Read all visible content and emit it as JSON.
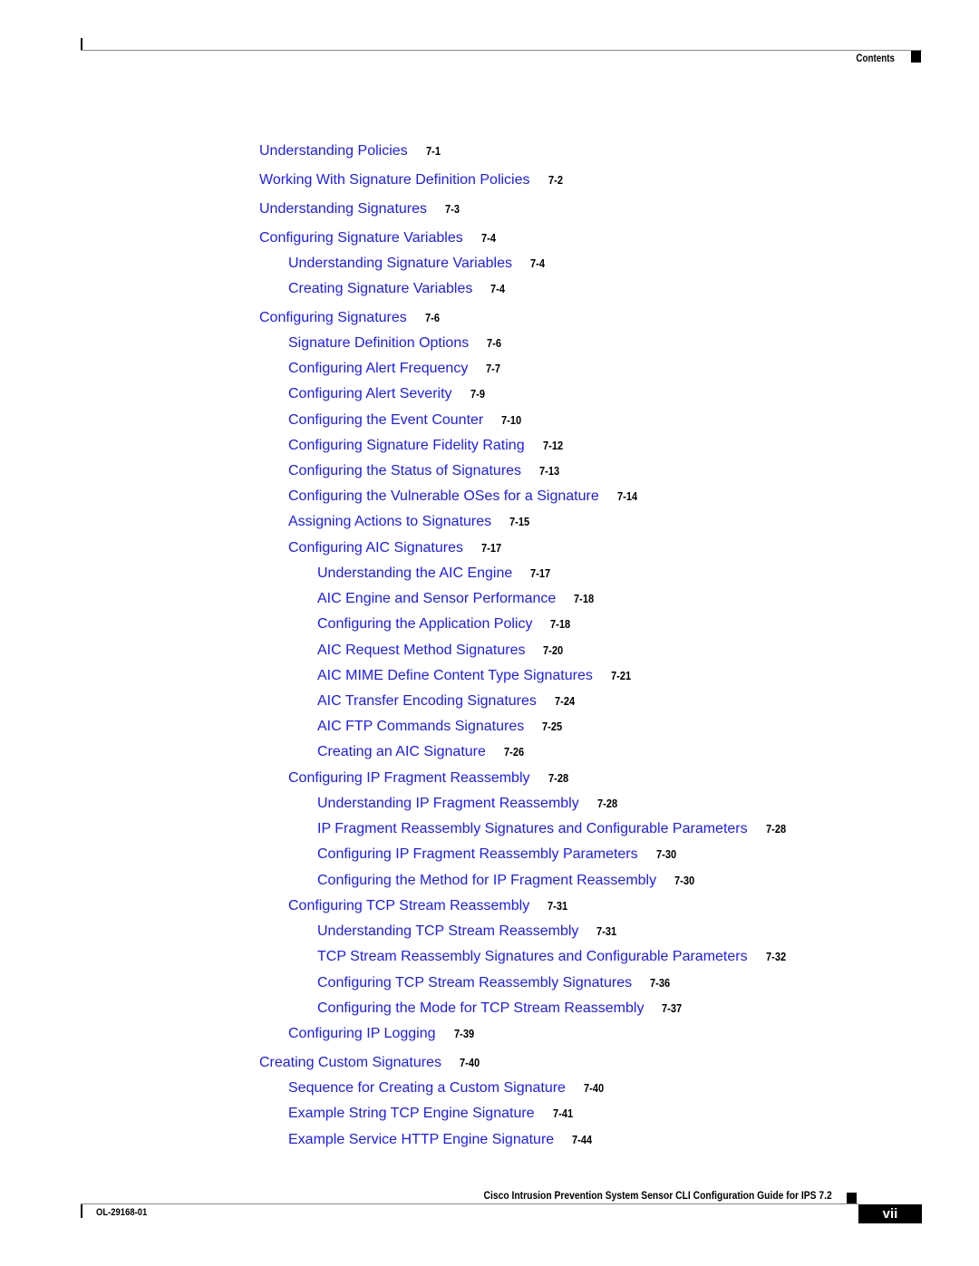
{
  "header": {
    "section_label": "Contents"
  },
  "toc": [
    {
      "level": 1,
      "title": "Understanding Policies",
      "page": "7-1"
    },
    {
      "level": 1,
      "title": "Working With Signature Definition Policies",
      "page": "7-2"
    },
    {
      "level": 1,
      "title": "Understanding Signatures",
      "page": "7-3"
    },
    {
      "level": 1,
      "title": "Configuring Signature Variables",
      "page": "7-4"
    },
    {
      "level": 2,
      "title": "Understanding Signature Variables",
      "page": "7-4"
    },
    {
      "level": 2,
      "title": "Creating Signature Variables",
      "page": "7-4"
    },
    {
      "level": 1,
      "title": "Configuring Signatures",
      "page": "7-6"
    },
    {
      "level": 2,
      "title": "Signature Definition Options",
      "page": "7-6"
    },
    {
      "level": 2,
      "title": "Configuring Alert Frequency",
      "page": "7-7"
    },
    {
      "level": 2,
      "title": "Configuring Alert Severity",
      "page": "7-9"
    },
    {
      "level": 2,
      "title": "Configuring the Event Counter",
      "page": "7-10"
    },
    {
      "level": 2,
      "title": "Configuring Signature Fidelity Rating",
      "page": "7-12"
    },
    {
      "level": 2,
      "title": "Configuring the Status of Signatures",
      "page": "7-13"
    },
    {
      "level": 2,
      "title": "Configuring the Vulnerable OSes for a Signature",
      "page": "7-14"
    },
    {
      "level": 2,
      "title": "Assigning Actions to Signatures",
      "page": "7-15"
    },
    {
      "level": 2,
      "title": "Configuring AIC Signatures",
      "page": "7-17"
    },
    {
      "level": 3,
      "title": "Understanding the AIC Engine",
      "page": "7-17"
    },
    {
      "level": 3,
      "title": "AIC Engine and Sensor Performance",
      "page": "7-18"
    },
    {
      "level": 3,
      "title": "Configuring the Application Policy",
      "page": "7-18"
    },
    {
      "level": 3,
      "title": "AIC Request Method Signatures",
      "page": "7-20"
    },
    {
      "level": 3,
      "title": "AIC MIME Define Content Type Signatures",
      "page": "7-21"
    },
    {
      "level": 3,
      "title": "AIC Transfer Encoding Signatures",
      "page": "7-24"
    },
    {
      "level": 3,
      "title": "AIC FTP Commands Signatures",
      "page": "7-25"
    },
    {
      "level": 3,
      "title": "Creating an AIC Signature",
      "page": "7-26"
    },
    {
      "level": 2,
      "title": "Configuring IP Fragment Reassembly",
      "page": "7-28"
    },
    {
      "level": 3,
      "title": "Understanding IP Fragment Reassembly",
      "page": "7-28"
    },
    {
      "level": 3,
      "title": "IP Fragment Reassembly Signatures and Configurable Parameters",
      "page": "7-28"
    },
    {
      "level": 3,
      "title": "Configuring IP Fragment Reassembly Parameters",
      "page": "7-30"
    },
    {
      "level": 3,
      "title": "Configuring the Method for IP Fragment Reassembly",
      "page": "7-30"
    },
    {
      "level": 2,
      "title": "Configuring TCP Stream Reassembly",
      "page": "7-31"
    },
    {
      "level": 3,
      "title": "Understanding TCP Stream Reassembly",
      "page": "7-31"
    },
    {
      "level": 3,
      "title": "TCP Stream Reassembly Signatures and Configurable Parameters",
      "page": "7-32"
    },
    {
      "level": 3,
      "title": "Configuring TCP Stream Reassembly Signatures",
      "page": "7-36"
    },
    {
      "level": 3,
      "title": "Configuring the Mode for TCP Stream Reassembly",
      "page": "7-37"
    },
    {
      "level": 2,
      "title": "Configuring IP Logging",
      "page": "7-39"
    },
    {
      "level": 1,
      "title": "Creating Custom Signatures",
      "page": "7-40"
    },
    {
      "level": 2,
      "title": "Sequence for Creating a Custom Signature",
      "page": "7-40"
    },
    {
      "level": 2,
      "title": "Example String TCP Engine Signature",
      "page": "7-41"
    },
    {
      "level": 2,
      "title": "Example Service HTTP Engine Signature",
      "page": "7-44"
    }
  ],
  "footer": {
    "book_title": "Cisco Intrusion Prevention System Sensor CLI Configuration Guide for IPS 7.2",
    "doc_number": "OL-29168-01",
    "page_number": "vii"
  }
}
